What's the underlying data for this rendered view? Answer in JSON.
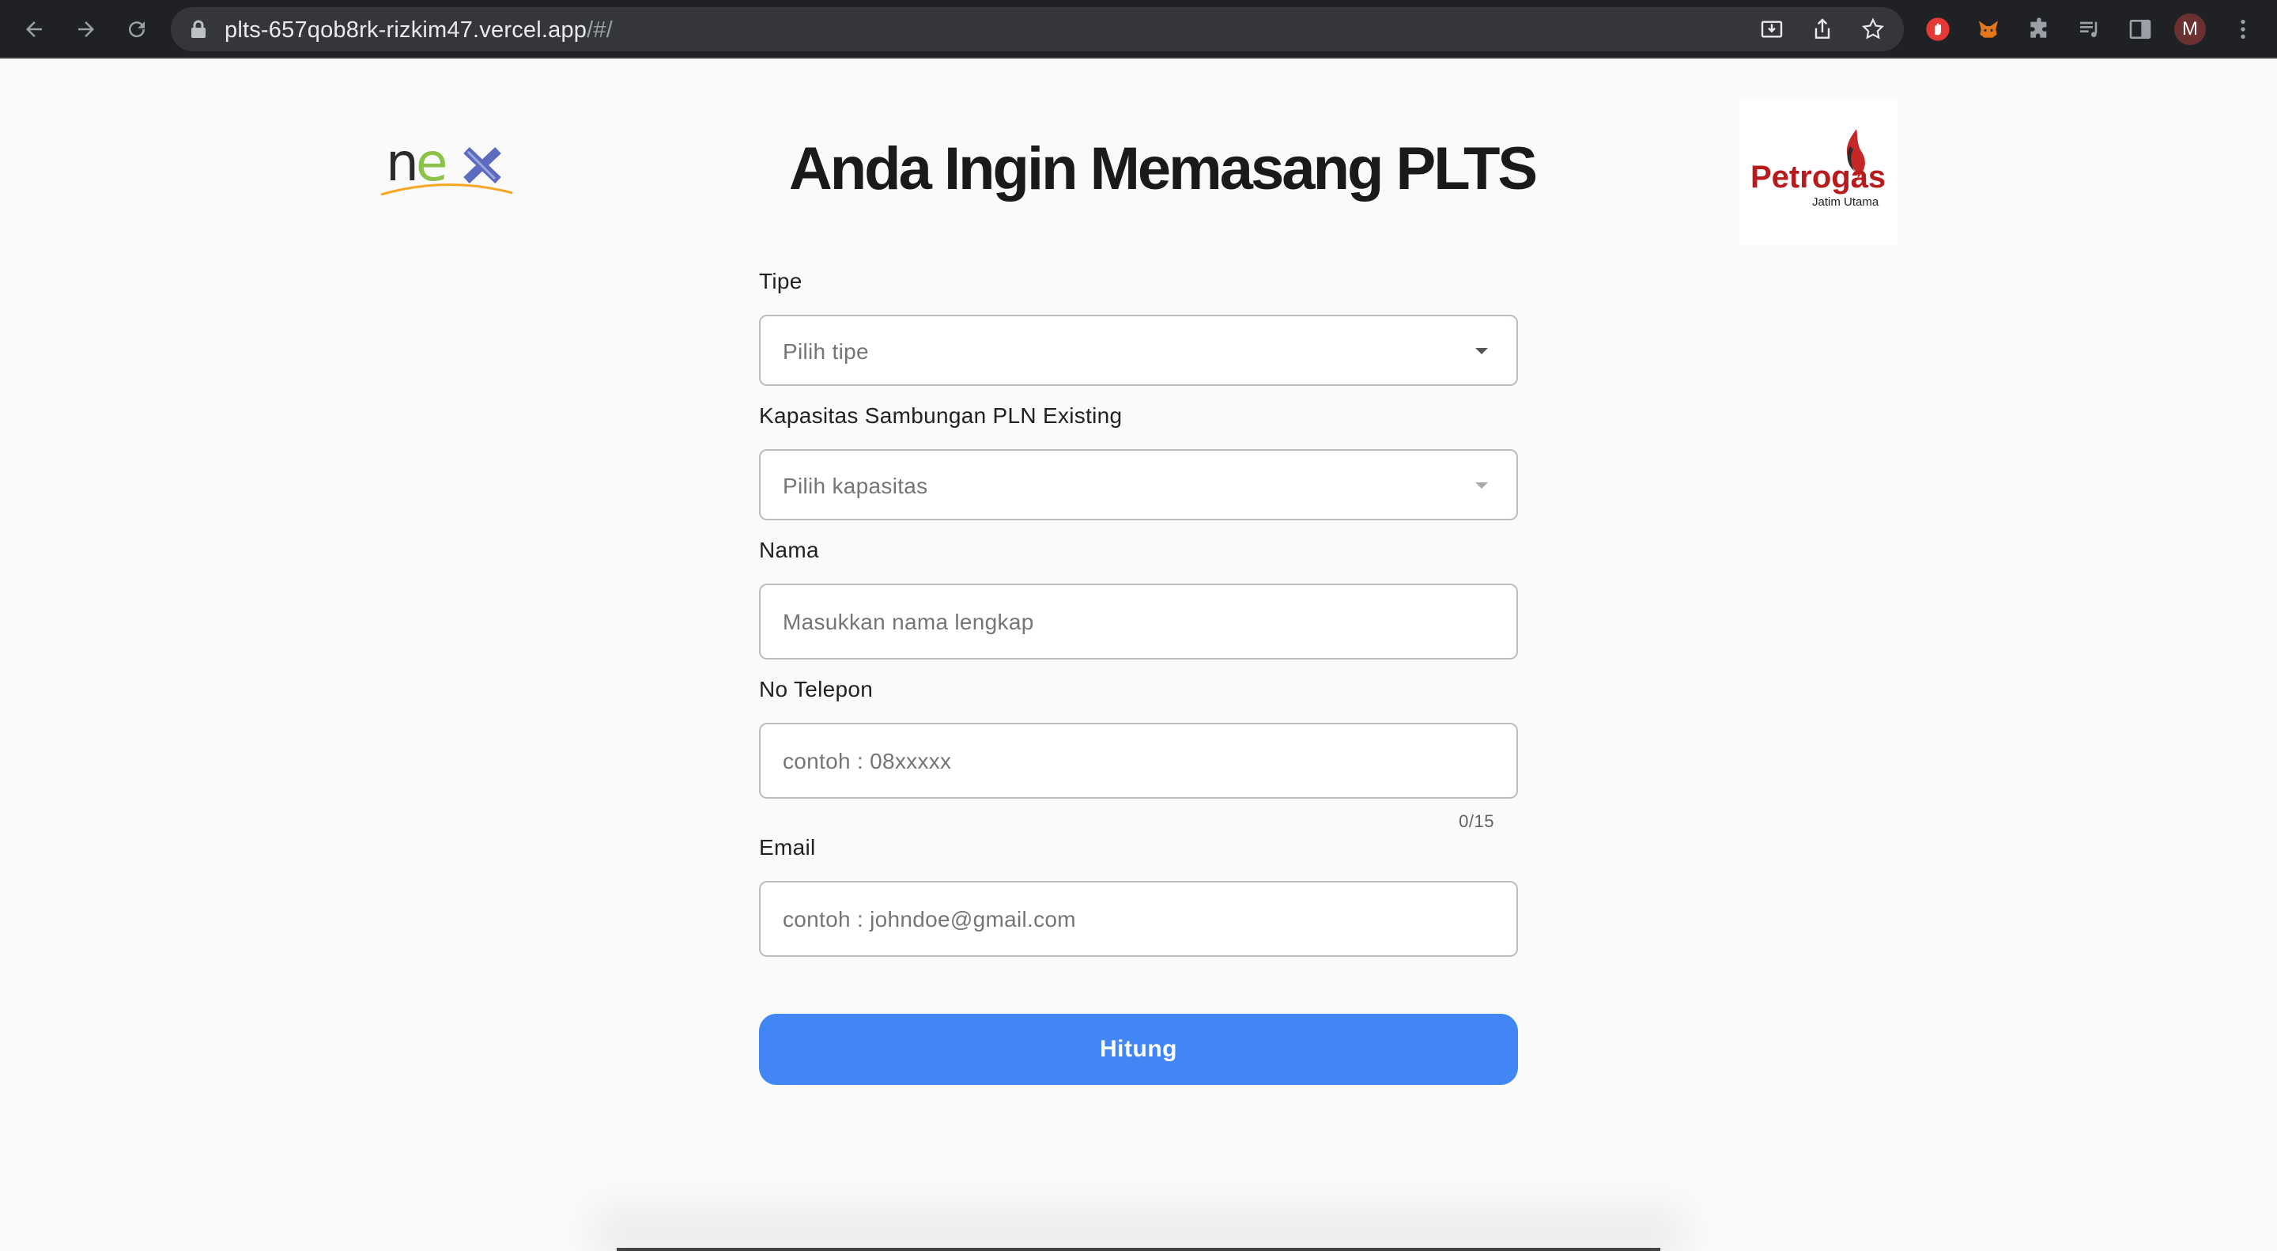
{
  "browser": {
    "url_host": "plts-657qob8rk-rizkim47.vercel.app",
    "url_path": "/#/",
    "profile_initial": "M"
  },
  "page": {
    "title": "Anda Ingin Memasang PLTS",
    "logos": {
      "left": "nex",
      "right_main": "Petrogas",
      "right_sub": "Jatim Utama"
    }
  },
  "form": {
    "tipe": {
      "label": "Tipe",
      "placeholder": "Pilih tipe"
    },
    "kapasitas": {
      "label": "Kapasitas Sambungan PLN Existing",
      "placeholder": "Pilih kapasitas"
    },
    "nama": {
      "label": "Nama",
      "placeholder": "Masukkan nama lengkap"
    },
    "telepon": {
      "label": "No Telepon",
      "placeholder": "contoh : 08xxxxx",
      "counter": "0/15"
    },
    "email": {
      "label": "Email",
      "placeholder": "contoh : johndoe@gmail.com"
    },
    "submit_label": "Hitung"
  },
  "colors": {
    "primary": "#4285f4",
    "nex_green": "#8bc34a",
    "nex_blue": "#5c6bc0",
    "petrogas_red": "#b71c1c"
  }
}
